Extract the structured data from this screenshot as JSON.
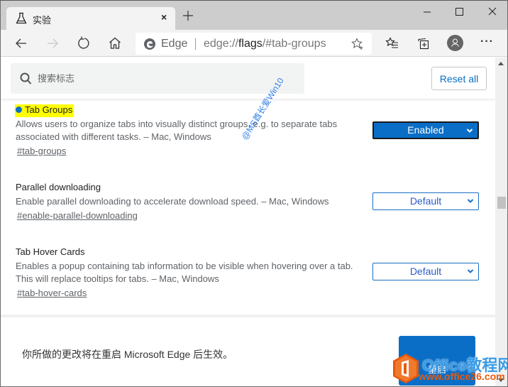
{
  "browser": {
    "tab": {
      "title": "实验",
      "icon": "beaker-icon",
      "close_glyph": "×"
    },
    "new_tab_icon": "plus-icon",
    "window_controls": [
      "minimize-icon",
      "maximize-icon",
      "close-icon"
    ],
    "toolbar": {
      "back_icon": "back-arrow-icon",
      "forward_icon": "forward-arrow-icon",
      "refresh_icon": "refresh-icon",
      "home_icon": "home-icon",
      "site_label": "Edge",
      "url_scheme": "edge://",
      "url_host": "flags",
      "url_path": "/#tab-groups",
      "favorite_icon": "add-favorite-star-icon",
      "favorites_icon": "favorites-list-icon",
      "collections_icon": "collections-icon",
      "profile_icon": "profile-avatar-icon",
      "more_glyph": "···"
    }
  },
  "page": {
    "search": {
      "placeholder": "搜索标志",
      "value": ""
    },
    "reset_all_label": "Reset all",
    "experiments": [
      {
        "title": "Tab Groups",
        "highlighted": true,
        "modified": true,
        "description": "Allows users to organize tabs into visually distinct groups, e.g. to separate tabs associated with different tasks. – Mac, Windows",
        "link": "#tab-groups",
        "selected": "Enabled"
      },
      {
        "title": "Parallel downloading",
        "highlighted": false,
        "modified": false,
        "description": "Enable parallel downloading to accelerate download speed. – Mac, Windows",
        "link": "#enable-parallel-downloading",
        "selected": "Default"
      },
      {
        "title": "Tab Hover Cards",
        "highlighted": false,
        "modified": false,
        "description": "Enables a popup containing tab information to be visible when hovering over a tab. This will replace tooltips for tabs. – Mac, Windows",
        "link": "#tab-hover-cards",
        "selected": "Default"
      }
    ],
    "footer": {
      "message": "你所做的更改将在重启 Microsoft Edge 后生效。",
      "restart_label": "重启"
    }
  },
  "watermarks": {
    "diagonal": "@MS酋长爱Win10",
    "brand": "Office教程网",
    "url": "www.office26.com"
  },
  "colors": {
    "accent": "#0a6ec7",
    "highlight": "#ffff00",
    "titlebar": "#cdcdcd",
    "toolbar": "#f3f3f3"
  }
}
